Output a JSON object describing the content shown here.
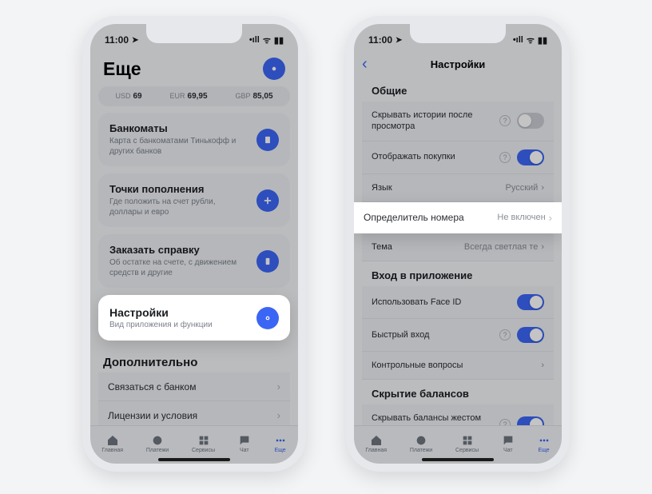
{
  "status": {
    "time": "11:00",
    "carrier_glyph": "◀",
    "right_glyphs": "••ıl ⌃ ▆"
  },
  "phone1": {
    "title": "Еще",
    "rates": [
      {
        "lbl": "USD",
        "val": "69"
      },
      {
        "lbl": "EUR",
        "val": "69,95"
      },
      {
        "lbl": "GBP",
        "val": "85,05"
      }
    ],
    "cards": [
      {
        "t": "Банкоматы",
        "s": "Карта с банкоматами Тинькофф и других банков",
        "icon": "atm"
      },
      {
        "t": "Точки пополнения",
        "s": "Где положить на счет рубли, доллары и евро",
        "icon": "plus"
      },
      {
        "t": "Заказать справку",
        "s": "Об остатке на счете, с движением средств и другие",
        "icon": "doc"
      }
    ],
    "settings_card": {
      "t": "Настройки",
      "s": "Вид приложения и функции"
    },
    "extra_head": "Дополнительно",
    "extra_items": [
      "Связаться с банком",
      "Лицензии и условия"
    ],
    "tabs": [
      "Главная",
      "Платежи",
      "Сервисы",
      "Чат",
      "Еще"
    ]
  },
  "phone2": {
    "nav_title": "Настройки",
    "g1_head": "Общие",
    "g1": [
      {
        "lab": "Скрывать истории после просмотра",
        "type": "toggle",
        "on": false,
        "hint": true
      },
      {
        "lab": "Отображать покупки",
        "type": "toggle",
        "on": true,
        "hint": true
      },
      {
        "lab": "Язык",
        "type": "link",
        "val": "Русский"
      }
    ],
    "highlight": {
      "lab": "Определитель номера",
      "val": "Не включен"
    },
    "g1b": [
      {
        "lab": "Тема",
        "type": "link",
        "val": "Всегда светлая те"
      }
    ],
    "g2_head": "Вход в приложение",
    "g2": [
      {
        "lab": "Использовать Face ID",
        "type": "toggle",
        "on": true
      },
      {
        "lab": "Быстрый вход",
        "type": "toggle",
        "on": true,
        "hint": true
      },
      {
        "lab": "Контрольные вопросы",
        "type": "link",
        "val": ""
      }
    ],
    "g3_head": "Скрытие балансов",
    "g3": [
      {
        "lab": "Скрывать балансы жестом переворота",
        "type": "toggle",
        "on": true,
        "hint": true
      }
    ],
    "tabs": [
      "Главная",
      "Платежи",
      "Сервисы",
      "Чат",
      "Еще"
    ]
  }
}
